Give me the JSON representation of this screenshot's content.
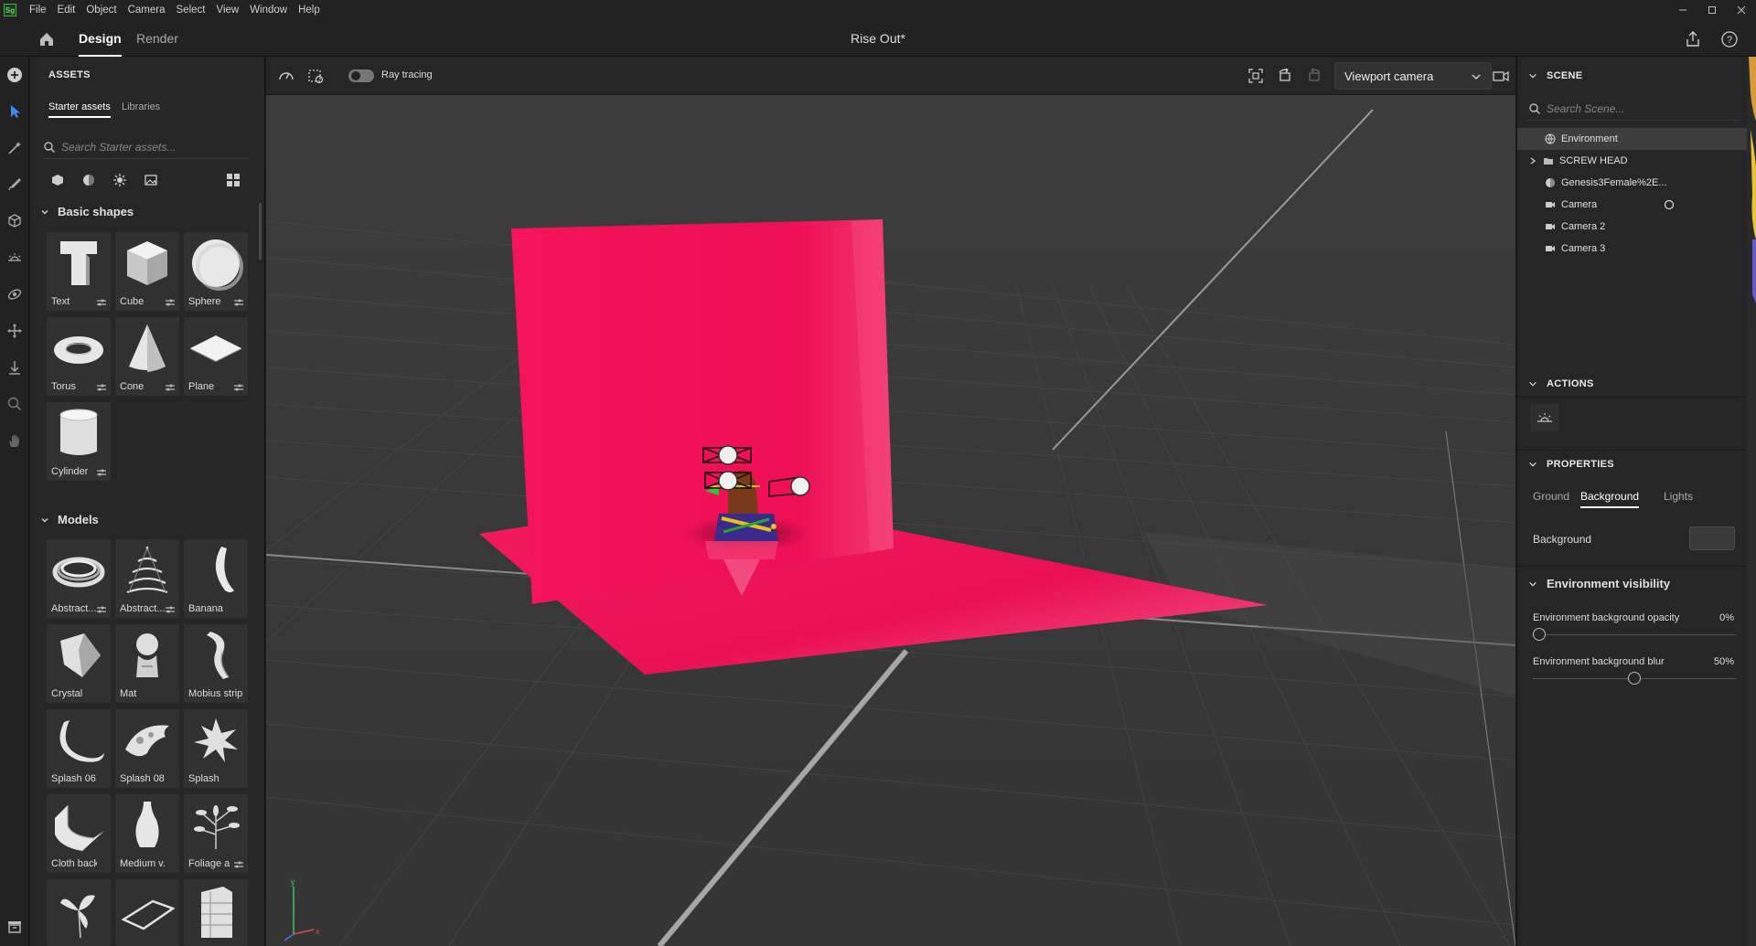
{
  "menubar": {
    "logo": "Sg",
    "items": [
      "File",
      "Edit",
      "Object",
      "Camera",
      "Select",
      "View",
      "Window",
      "Help"
    ]
  },
  "titlebar": {
    "tabs": [
      "Design",
      "Render"
    ],
    "document_title": "Rise Out*"
  },
  "assets": {
    "title": "ASSETS",
    "tabs": [
      "Starter assets",
      "Libraries"
    ],
    "search_placeholder": "Search Starter assets...",
    "basic_shapes_title": "Basic shapes",
    "basic_shapes": [
      "Text",
      "Cube",
      "Sphere",
      "Torus",
      "Cone",
      "Plane",
      "Cylinder"
    ],
    "models_title": "Models",
    "models": [
      "Abstract...",
      "Abstract...",
      "Banana",
      "Crystal",
      "Mat",
      "Mobius strip",
      "Splash 06",
      "Splash 08",
      "Splash",
      "Cloth back...",
      "Medium v...",
      "Foliage a"
    ]
  },
  "viewport": {
    "ray_tracing_label": "Ray tracing",
    "ray_tracing_on": true,
    "camera_select": "Viewport camera",
    "axis_labels": [
      "y",
      "x"
    ],
    "colors": {
      "backdrop": "#f0115a",
      "grid_bg": "#3a3a3a"
    }
  },
  "scene": {
    "title": "SCENE",
    "search_placeholder": "Search Scene...",
    "items": [
      {
        "label": "Environment",
        "icon": "globe-icon",
        "selected": true
      },
      {
        "label": "SCREW HEAD",
        "icon": "folder-icon",
        "expandable": true
      },
      {
        "label": "Genesis3Female%2E...",
        "icon": "model-icon"
      },
      {
        "label": "Camera",
        "icon": "camera-icon",
        "active": true
      },
      {
        "label": "Camera 2",
        "icon": "camera-icon"
      },
      {
        "label": "Camera 3",
        "icon": "camera-icon"
      }
    ]
  },
  "actions": {
    "title": "ACTIONS"
  },
  "properties": {
    "title": "PROPERTIES",
    "tabs": [
      "Ground",
      "Background",
      "Lights"
    ],
    "active_tab": "Background",
    "background_label": "Background",
    "background_color": "#3a3a3a",
    "env_visibility_title": "Environment visibility",
    "opacity_label": "Environment background opacity",
    "opacity_value": "0%",
    "blur_label": "Environment background blur",
    "blur_value": "50%"
  }
}
